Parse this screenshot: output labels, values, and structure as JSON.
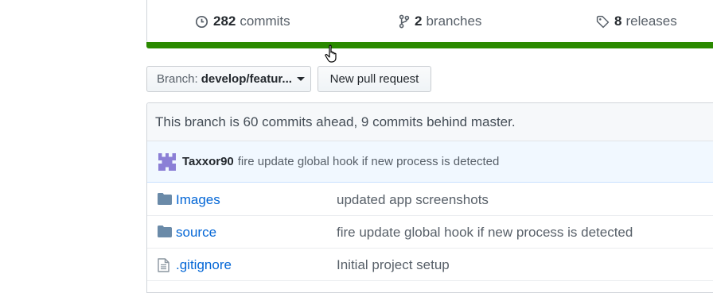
{
  "summary": {
    "commits": {
      "count": "282",
      "label": "commits"
    },
    "branches": {
      "count": "2",
      "label": "branches"
    },
    "releases": {
      "count": "8",
      "label": "releases"
    },
    "language_color": "#2b8a00"
  },
  "toolbar": {
    "branch_prefix": "Branch:",
    "branch_name": "develop/featur...",
    "new_pr_label": "New pull request"
  },
  "branch_status": "This branch is 60 commits ahead, 9 commits behind master.",
  "latest_commit": {
    "author": "Taxxor90",
    "message": "fire update global hook if new process is detected"
  },
  "files": [
    {
      "type": "folder",
      "icon": "folder-icon",
      "name": "Images",
      "message": "updated app screenshots"
    },
    {
      "type": "folder",
      "icon": "folder-icon",
      "name": "source",
      "message": "fire update global hook if new process is detected"
    },
    {
      "type": "file",
      "icon": "file-icon",
      "name": ".gitignore",
      "message": "Initial project setup"
    }
  ]
}
